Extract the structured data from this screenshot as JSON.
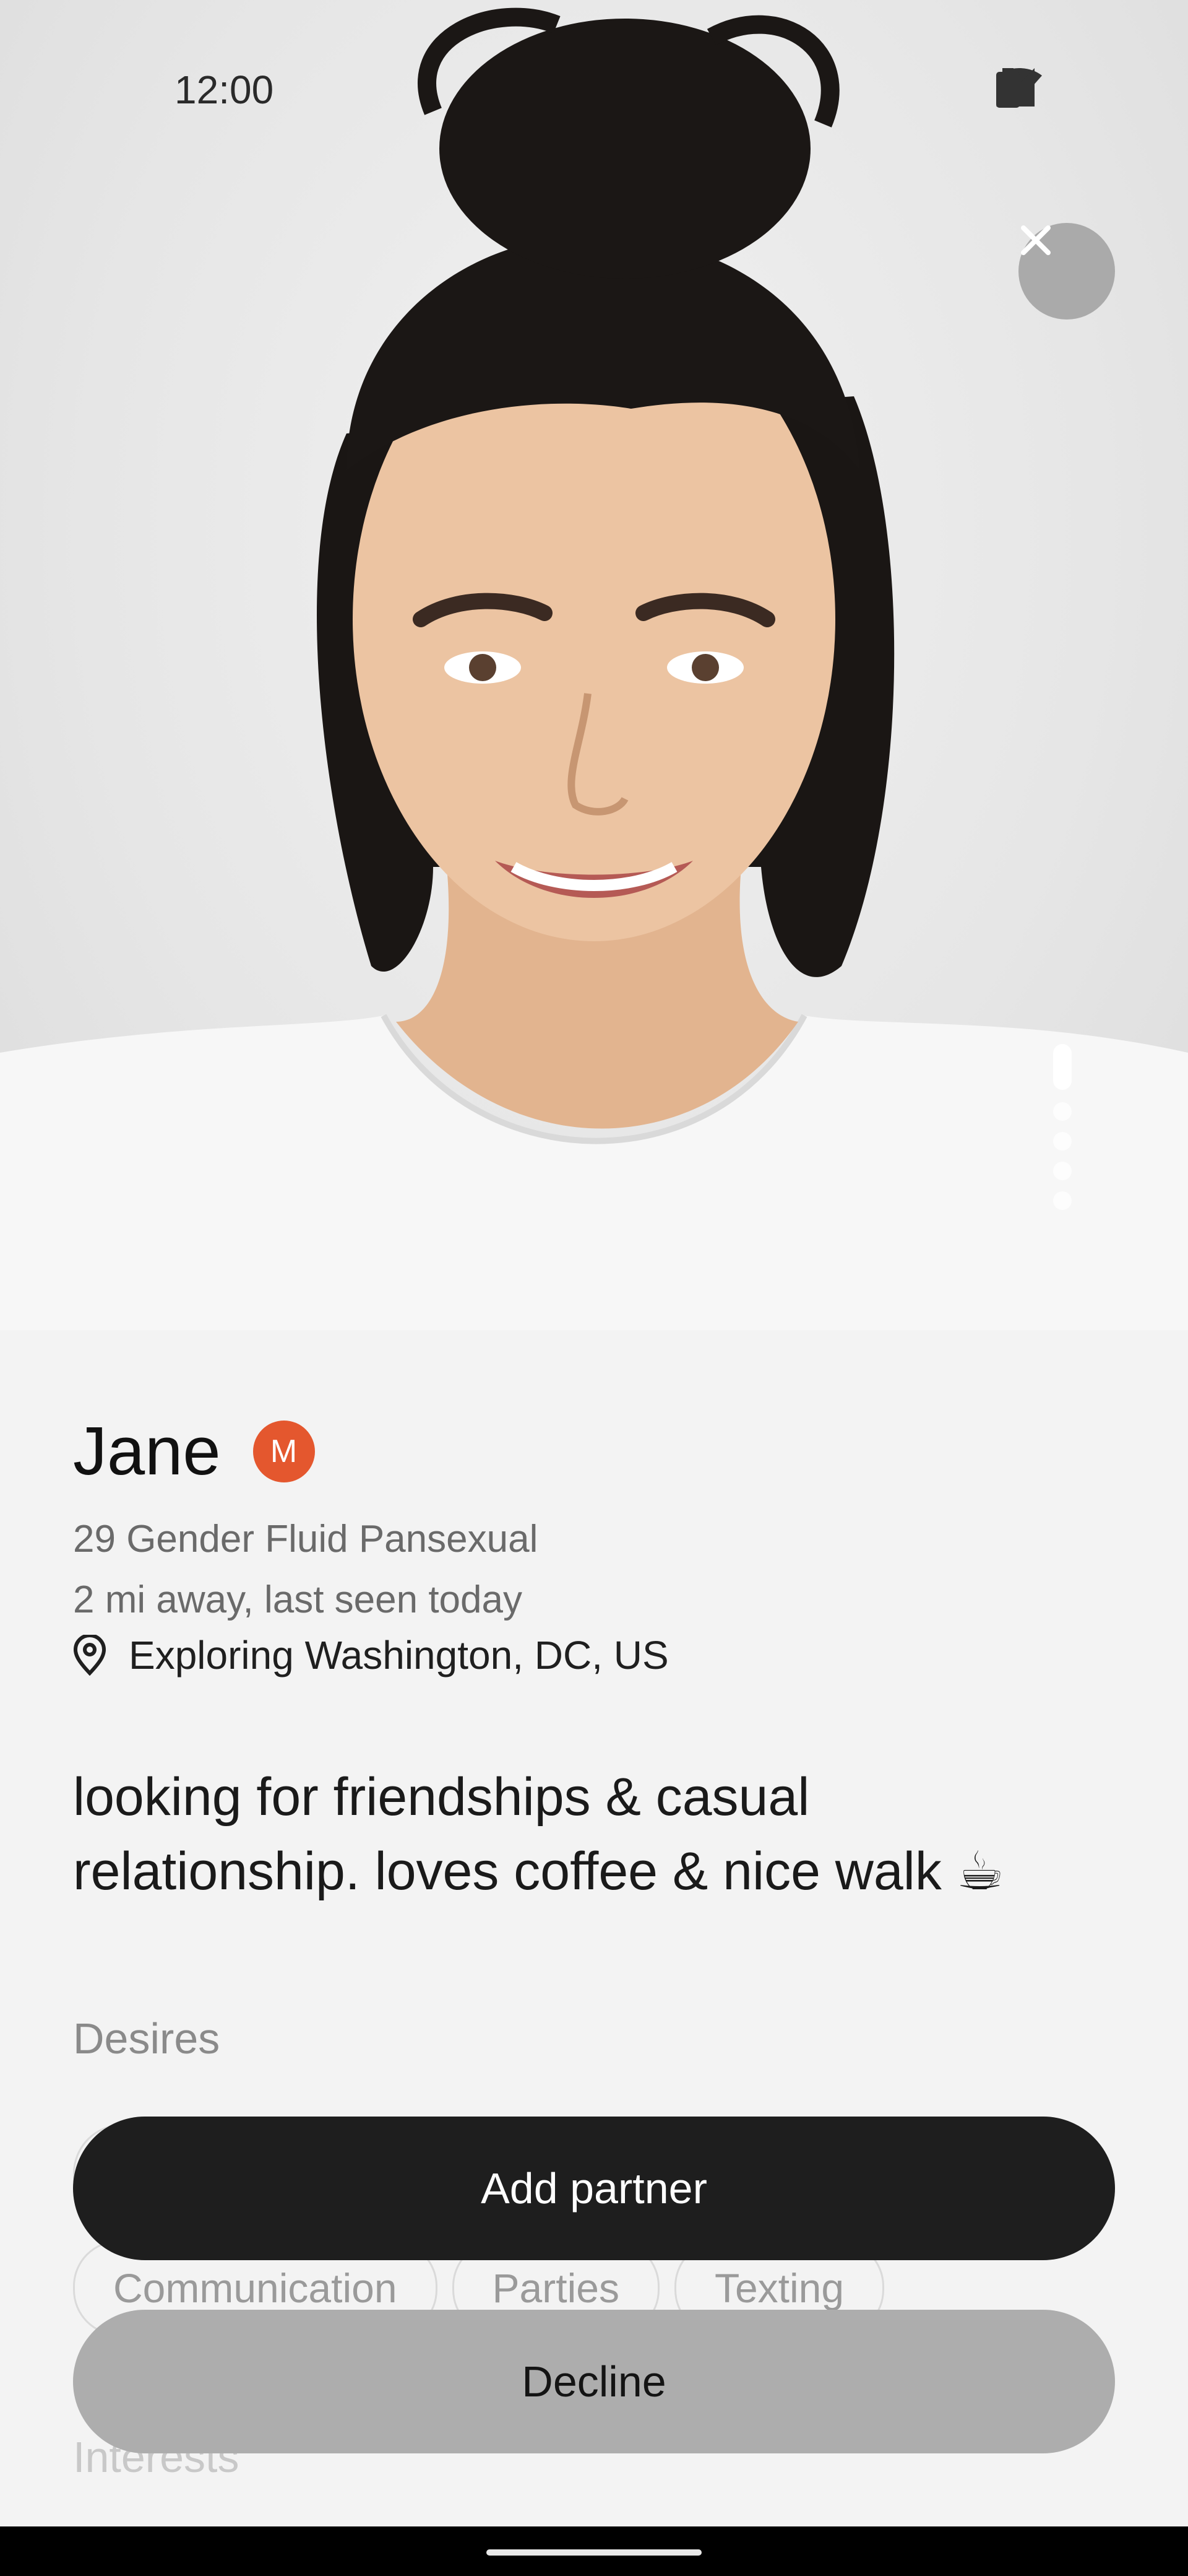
{
  "status_bar": {
    "time": "12:00",
    "icons": [
      "wifi-icon",
      "cellular-signal-icon",
      "battery-icon"
    ]
  },
  "photo": {
    "description_icon": "profile-photo",
    "close_icon": "close-icon",
    "pages_total": 6,
    "current_page": 1
  },
  "profile": {
    "name": "Jane",
    "badge_letter": "M",
    "details_line": "29 Gender Fluid Pansexual",
    "distance_line": "2 mi away, last seen today",
    "location": "Exploring Washington, DC, US",
    "bio_line1": "looking for friendships & casual",
    "bio_line2": "relationship. loves coffee & nice walk ☕"
  },
  "sections": {
    "desires_label": "Desires",
    "interests_label": "Interests"
  },
  "desires": [
    "Communication",
    "Parties",
    "Texting"
  ],
  "actions": {
    "add_partner": "Add partner",
    "decline": "Decline"
  },
  "colors": {
    "badge": "#e4572e",
    "primary_button": "#1e1e1e",
    "secondary_button": "#adadad"
  }
}
